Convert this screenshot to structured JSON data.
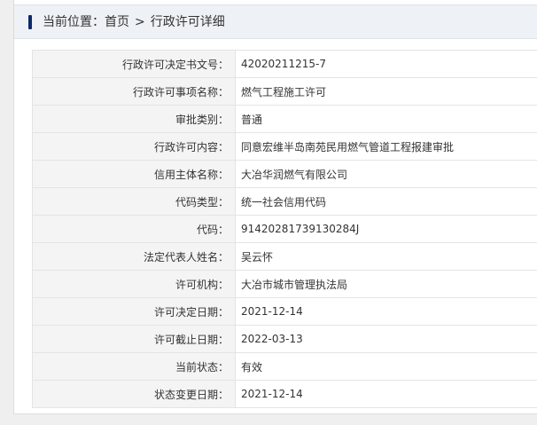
{
  "breadcrumb": {
    "prefix": "当前位置：",
    "home": "首页",
    "separator": ">",
    "current": "行政许可详细"
  },
  "colors": {
    "accent_bar": "#0b2a6b",
    "header_bg": "#eef1f5",
    "label_bg": "#f4f4f4"
  },
  "rows": [
    {
      "label": "行政许可决定书文号：",
      "value": "42020211215-7"
    },
    {
      "label": "行政许可事项名称：",
      "value": "燃气工程施工许可"
    },
    {
      "label": "审批类别：",
      "value": "普通"
    },
    {
      "label": "行政许可内容：",
      "value": "同意宏维半岛南苑民用燃气管道工程报建审批"
    },
    {
      "label": "信用主体名称：",
      "value": "大冶华润燃气有限公司"
    },
    {
      "label": "代码类型：",
      "value": "统一社会信用代码"
    },
    {
      "label": "代码：",
      "value": "91420281739130284J"
    },
    {
      "label": "法定代表人姓名：",
      "value": "吴云怀"
    },
    {
      "label": "许可机构：",
      "value": "大冶市城市管理执法局"
    },
    {
      "label": "许可决定日期：",
      "value": "2021-12-14"
    },
    {
      "label": "许可截止日期：",
      "value": "2022-03-13"
    },
    {
      "label": "当前状态：",
      "value": "有效"
    },
    {
      "label": "状态变更日期：",
      "value": "2021-12-14"
    }
  ]
}
